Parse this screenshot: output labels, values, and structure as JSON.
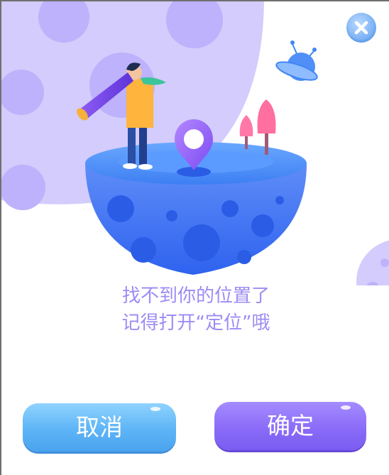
{
  "dialog": {
    "message_line1": "找不到你的位置了",
    "message_line2": "记得打开“定位”哦",
    "cancel_label": "取消",
    "confirm_label": "确定",
    "close_icon": "close-icon"
  },
  "colors": {
    "text": "#9c8cf4",
    "cancel": "#5db4f6",
    "confirm": "#8a6cf8",
    "moon": "#c9c1fb",
    "planet": "#3f86f5"
  }
}
